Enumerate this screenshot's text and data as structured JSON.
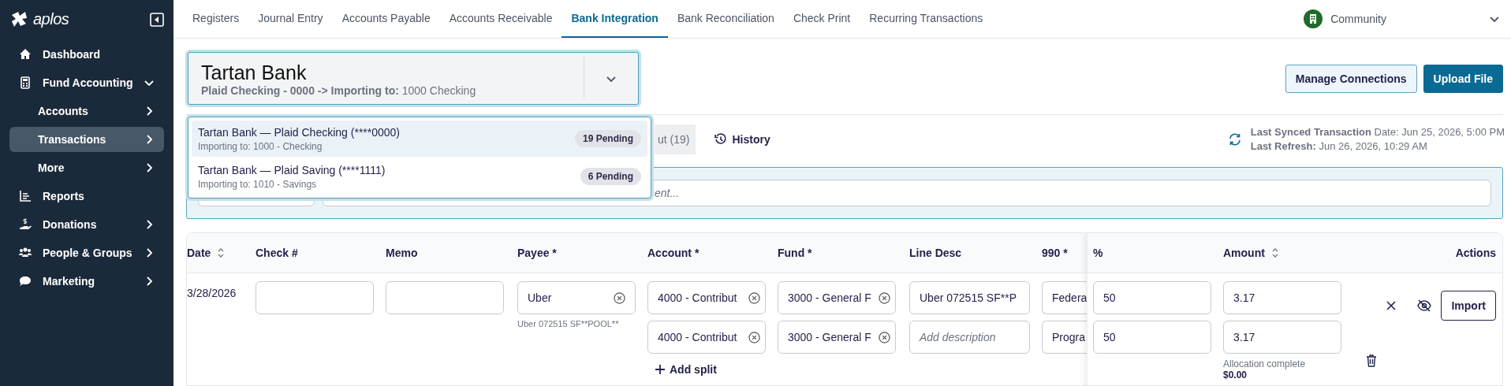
{
  "sidebar": {
    "logo": "aplos",
    "items": [
      {
        "label": "Dashboard",
        "submenu": false,
        "expanded": false,
        "selected": false
      },
      {
        "label": "Fund Accounting",
        "submenu": true,
        "expanded": true,
        "selected": false,
        "children": [
          {
            "label": "Accounts",
            "submenu": true,
            "selected": false
          },
          {
            "label": "Transactions",
            "submenu": true,
            "selected": true
          },
          {
            "label": "More",
            "submenu": true,
            "selected": false
          }
        ]
      },
      {
        "label": "Reports",
        "submenu": false,
        "expanded": false,
        "selected": false
      },
      {
        "label": "Donations",
        "submenu": true,
        "expanded": false,
        "selected": false
      },
      {
        "label": "People & Groups",
        "submenu": true,
        "expanded": false,
        "selected": false
      },
      {
        "label": "Marketing",
        "submenu": true,
        "expanded": false,
        "selected": false
      }
    ]
  },
  "top_nav": {
    "tabs": [
      {
        "label": "Registers",
        "selected": false
      },
      {
        "label": "Journal Entry",
        "selected": false
      },
      {
        "label": "Accounts Payable",
        "selected": false
      },
      {
        "label": "Accounts Receivable",
        "selected": false
      },
      {
        "label": "Bank Integration",
        "selected": true
      },
      {
        "label": "Bank Reconciliation",
        "selected": false
      },
      {
        "label": "Check Print",
        "selected": false
      },
      {
        "label": "Recurring Transactions",
        "selected": false
      }
    ],
    "organization": "Community"
  },
  "bank_selector": {
    "bank": "Tartan Bank",
    "detail": "**Plaid Checking - 0000 -> Importing to:** 1000 Checking",
    "open": true,
    "options": [
      {
        "title": "Tartan Bank — Plaid Checking (****0000)",
        "subtitle": "Importing to: 1000 - Checking",
        "badge": "19 Pending",
        "selected": true
      },
      {
        "title": "Tartan Bank — Plaid Saving (****1111)",
        "subtitle": "Importing to: 1010 - Savings",
        "badge": "6 Pending",
        "selected": false
      }
    ]
  },
  "header_buttons": [
    {
      "label": "Manage Connections",
      "kind": "secondary"
    },
    {
      "label": "Upload File",
      "kind": "primary"
    }
  ],
  "toolbar": {
    "partial_button": "ut (19)",
    "history": "History"
  },
  "sync": {
    "last_synced": "**Last Synced Transaction** Date: Jun 25, 2026, 5:00 PM",
    "last_refresh": "**Last Refresh:** Jun 26, 2026, 10:29 AM"
  },
  "filters": {
    "search_placeholder": "ent..."
  },
  "table": {
    "columns": [
      {
        "label": "Date",
        "sortable": true
      },
      {
        "label": "Check #",
        "sortable": false
      },
      {
        "label": "Memo",
        "sortable": false
      },
      {
        "label": "Payee *",
        "sortable": false
      },
      {
        "label": "Account *",
        "sortable": false
      },
      {
        "label": "Fund *",
        "sortable": false
      },
      {
        "label": "Line Desc",
        "sortable": false
      },
      {
        "label": "990 *",
        "sortable": false
      }
    ],
    "fixed_columns": [
      {
        "label": "%",
        "sortable": false
      },
      {
        "label": "Amount",
        "sortable": true
      },
      {
        "label": "Actions",
        "sortable": false
      }
    ],
    "rows": [
      {
        "date": "3/28/2026",
        "payee": "Uber",
        "payee_note": "Uber 072515 SF**POOL**",
        "splits": [
          {
            "account": "4000 - Contribut",
            "fund": "3000 - General F",
            "line_desc": "Uber 072515 SF**P",
            "col_990": "Federa",
            "percent": "50",
            "amount": "3.17",
            "removable": false
          },
          {
            "account": "4000 - Contribut",
            "fund": "3000 - General F",
            "line_desc_placeholder": "Add description",
            "col_990": "Progra",
            "percent": "50",
            "amount": "3.17",
            "removable": true
          }
        ],
        "add_split": "Add split",
        "allocation_label": "Allocation complete",
        "allocation_value": "$0.00",
        "import_label": "Import"
      }
    ]
  }
}
